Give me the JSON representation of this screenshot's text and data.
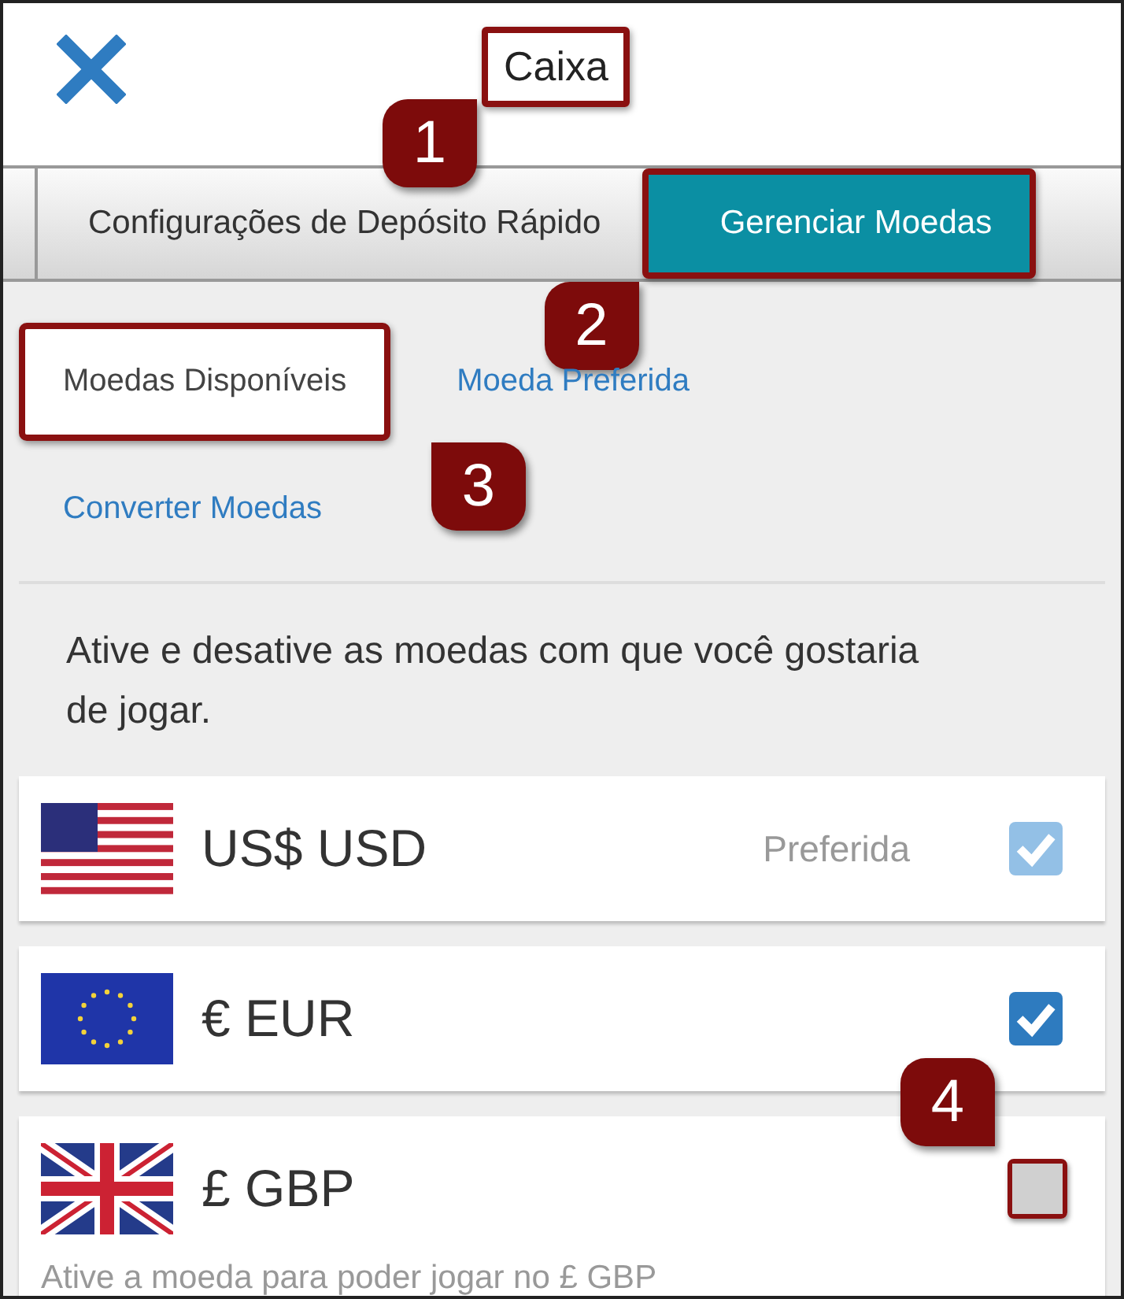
{
  "header": {
    "title": "Caixa",
    "highlighted": true,
    "callout": "1"
  },
  "tabs": [
    {
      "label": "Configurações de Depósito Rápido",
      "selected": false,
      "highlighted": false
    },
    {
      "label": "Gerenciar Moedas",
      "selected": true,
      "highlighted": true,
      "callout": "2"
    }
  ],
  "subtabs": [
    {
      "label": "Moedas Disponíveis",
      "selected": true,
      "highlighted": true,
      "callout": "3"
    },
    {
      "label": "Moeda Preferida",
      "selected": false,
      "highlighted": false
    },
    {
      "label": "Converter Moedas",
      "selected": false,
      "highlighted": false
    }
  ],
  "intro": "Ative e desative as moedas com que você gostaria de jogar.",
  "currencies": [
    {
      "kind": "us",
      "name": "US$ USD",
      "note": "Preferida",
      "checked": true,
      "disabled": true,
      "highlighted": false
    },
    {
      "kind": "eu",
      "name": "€ EUR",
      "checked": true,
      "disabled": false,
      "highlighted": false
    },
    {
      "kind": "gb",
      "name": "£ GBP",
      "checked": false,
      "disabled": false,
      "highlighted": true,
      "callout": "4",
      "hint": "Ative a moeda para poder jogar no £ GBP"
    }
  ]
}
